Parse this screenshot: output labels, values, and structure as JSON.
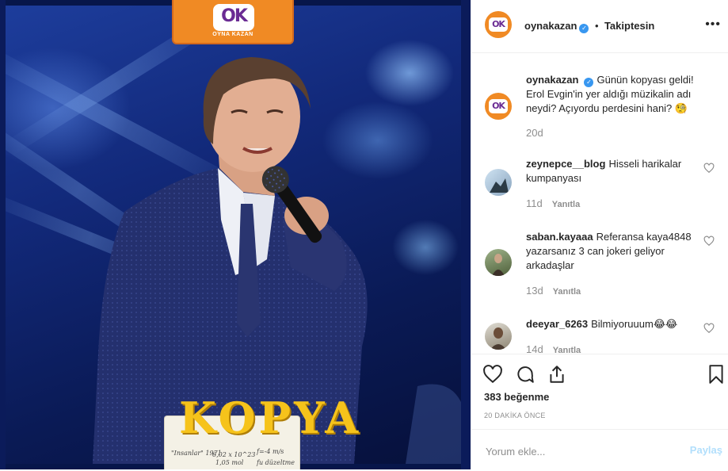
{
  "media": {
    "logo_text": "OK",
    "logo_subtitle": "OYNA KAZAN",
    "badge_word": "KOPYA",
    "badge_scribbles": [
      "\"Insanlar\" 1971",
      "6,02 x 10^23",
      "1,05 mol",
      "f=-4 m/s",
      "fu düzeltme"
    ]
  },
  "header": {
    "username": "oynakazan",
    "separator": "•",
    "follow_status": "Takiptesin",
    "more_label": "•••"
  },
  "caption": {
    "username": "oynakazan",
    "text": "Günün kopyası geldi! Erol Evgin'in yer aldığı müzikalin adı neydi? Açıyordu perdesini hani? 🧐",
    "time": "20d"
  },
  "comments": [
    {
      "username": "zeynepce__blog",
      "text": "Hisseli harikalar kumpanyası",
      "time": "11d",
      "reply": "Yanıtla"
    },
    {
      "username": "saban.kayaaa",
      "text": "Referansa kaya4848 yazarsanız 3 can jokeri geliyor arkadaşlar",
      "time": "13d",
      "reply": "Yanıtla"
    },
    {
      "username": "deeyar_6263",
      "text": "Bilmiyoruuum😂😂",
      "time": "14d",
      "reply": "Yanıtla"
    }
  ],
  "likes": "383 beğenme",
  "time_ago": "20 DAKİKA ÖNCE",
  "comment_input": {
    "placeholder": "Yorum ekle...",
    "value": ""
  },
  "post_button": "Paylaş",
  "colors": {
    "brand_orange": "#f08a24",
    "brand_purple": "#6a2b93",
    "link_blue": "#3897f0",
    "muted": "#8e8e8e"
  },
  "icons": [
    "heart-icon",
    "comment-icon",
    "share-icon",
    "bookmark-icon",
    "verified-icon",
    "more-icon"
  ]
}
